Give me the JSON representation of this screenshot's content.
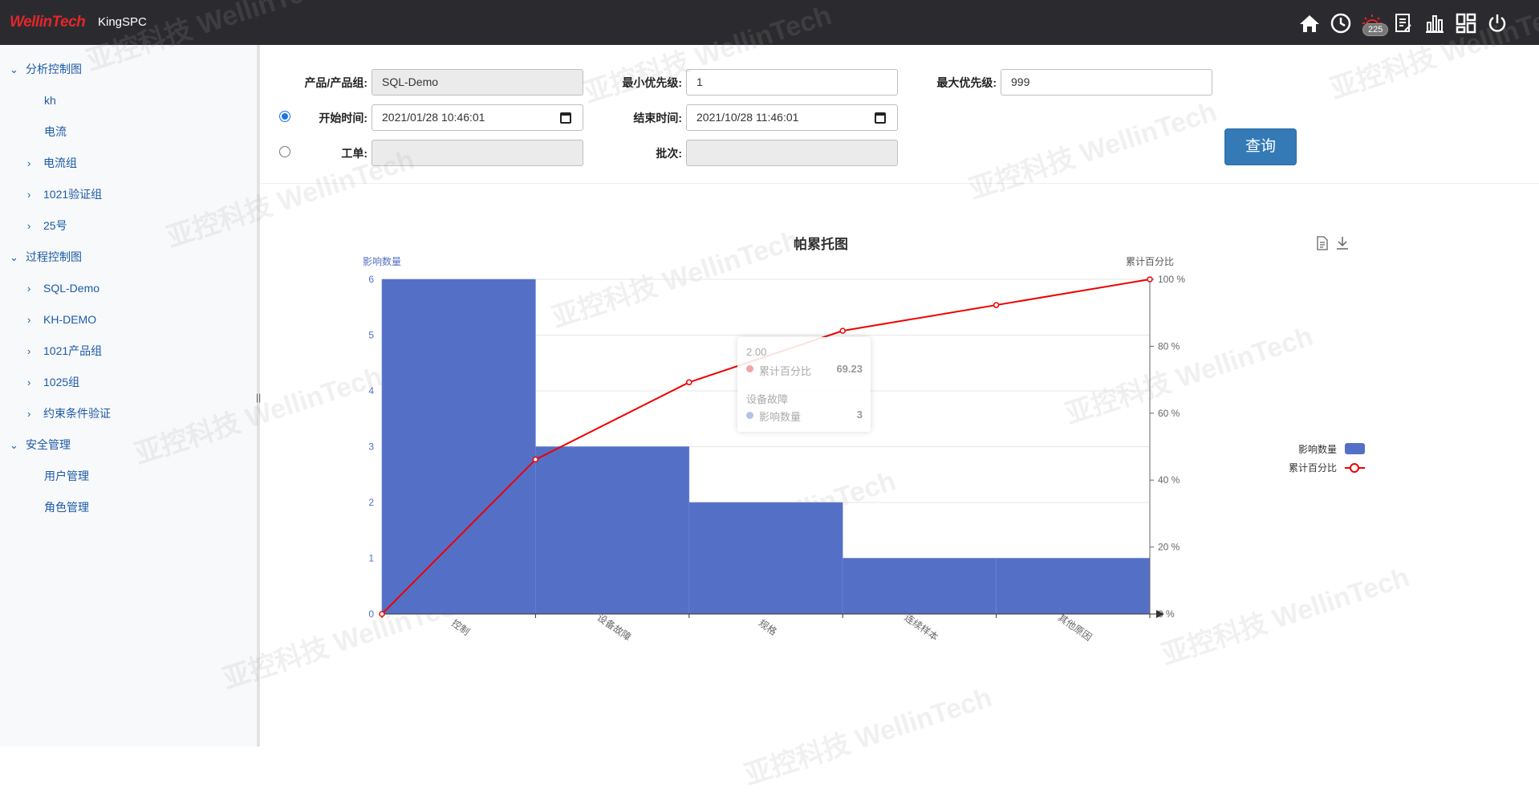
{
  "header": {
    "logo_text": "WellinTech",
    "app_name": "KingSPC",
    "notification_count": "225",
    "icons": [
      "home-icon",
      "history-icon",
      "alarm-icon",
      "report-icon",
      "chart-icon",
      "dashboard-icon",
      "power-icon"
    ]
  },
  "sidebar": {
    "groups": [
      {
        "label": "分析控制图",
        "items": [
          "kh",
          "电流",
          "电流组",
          "1021验证组",
          "25号"
        ]
      },
      {
        "label": "过程控制图",
        "items": [
          "SQL-Demo",
          "KH-DEMO",
          "1021产品组",
          "1025组",
          "约束条件验证"
        ]
      },
      {
        "label": "安全管理",
        "items": [
          "用户管理",
          "角色管理"
        ]
      }
    ]
  },
  "form": {
    "product_label": "产品/产品组:",
    "product_value": "SQL-Demo",
    "min_priority_label": "最小优先级:",
    "min_priority_value": "1",
    "max_priority_label": "最大优先级:",
    "max_priority_value": "999",
    "start_label": "开始时间:",
    "start_value": "2021/01/28 10:46:01",
    "end_label": "结束时间:",
    "end_value": "2021/10/28 11:46:01",
    "workorder_label": "工单:",
    "workorder_value": "",
    "batch_label": "批次:",
    "batch_value": "",
    "query_button": "查询"
  },
  "watermark_text": "亚控科技 WellinTech",
  "tooltip": {
    "x_value": "2.00",
    "line_name": "累计百分比",
    "line_value": "69.23",
    "category": "设备故障",
    "bar_name": "影响数量",
    "bar_value": "3"
  },
  "colors": {
    "bar": "#5470c6",
    "line": "#ee0000",
    "header_bg": "#2b2b2f",
    "accent": "#337ab7"
  },
  "chart_data": {
    "type": "bar",
    "title": "帕累托图",
    "categories": [
      "控制",
      "设备故障",
      "规格",
      "连续样本",
      "其他原因"
    ],
    "series": [
      {
        "name": "影响数量",
        "type": "bar",
        "values": [
          6,
          3,
          2,
          1,
          1
        ]
      },
      {
        "name": "累计百分比",
        "type": "line",
        "x": [
          0,
          1,
          2,
          3,
          4,
          5
        ],
        "values": [
          0,
          46.15,
          69.23,
          84.62,
          92.31,
          100
        ]
      }
    ],
    "ylabel": "影响数量",
    "y2label": "累计百分比",
    "ylim": [
      0,
      6
    ],
    "y2lim": [
      0,
      100
    ],
    "yticks": [
      "0",
      "1",
      "2",
      "3",
      "4",
      "5",
      "6"
    ],
    "y2ticks": [
      "0 %",
      "20 %",
      "40 %",
      "60 %",
      "80 %",
      "100 %"
    ],
    "legend_position": "right",
    "grid": true
  }
}
